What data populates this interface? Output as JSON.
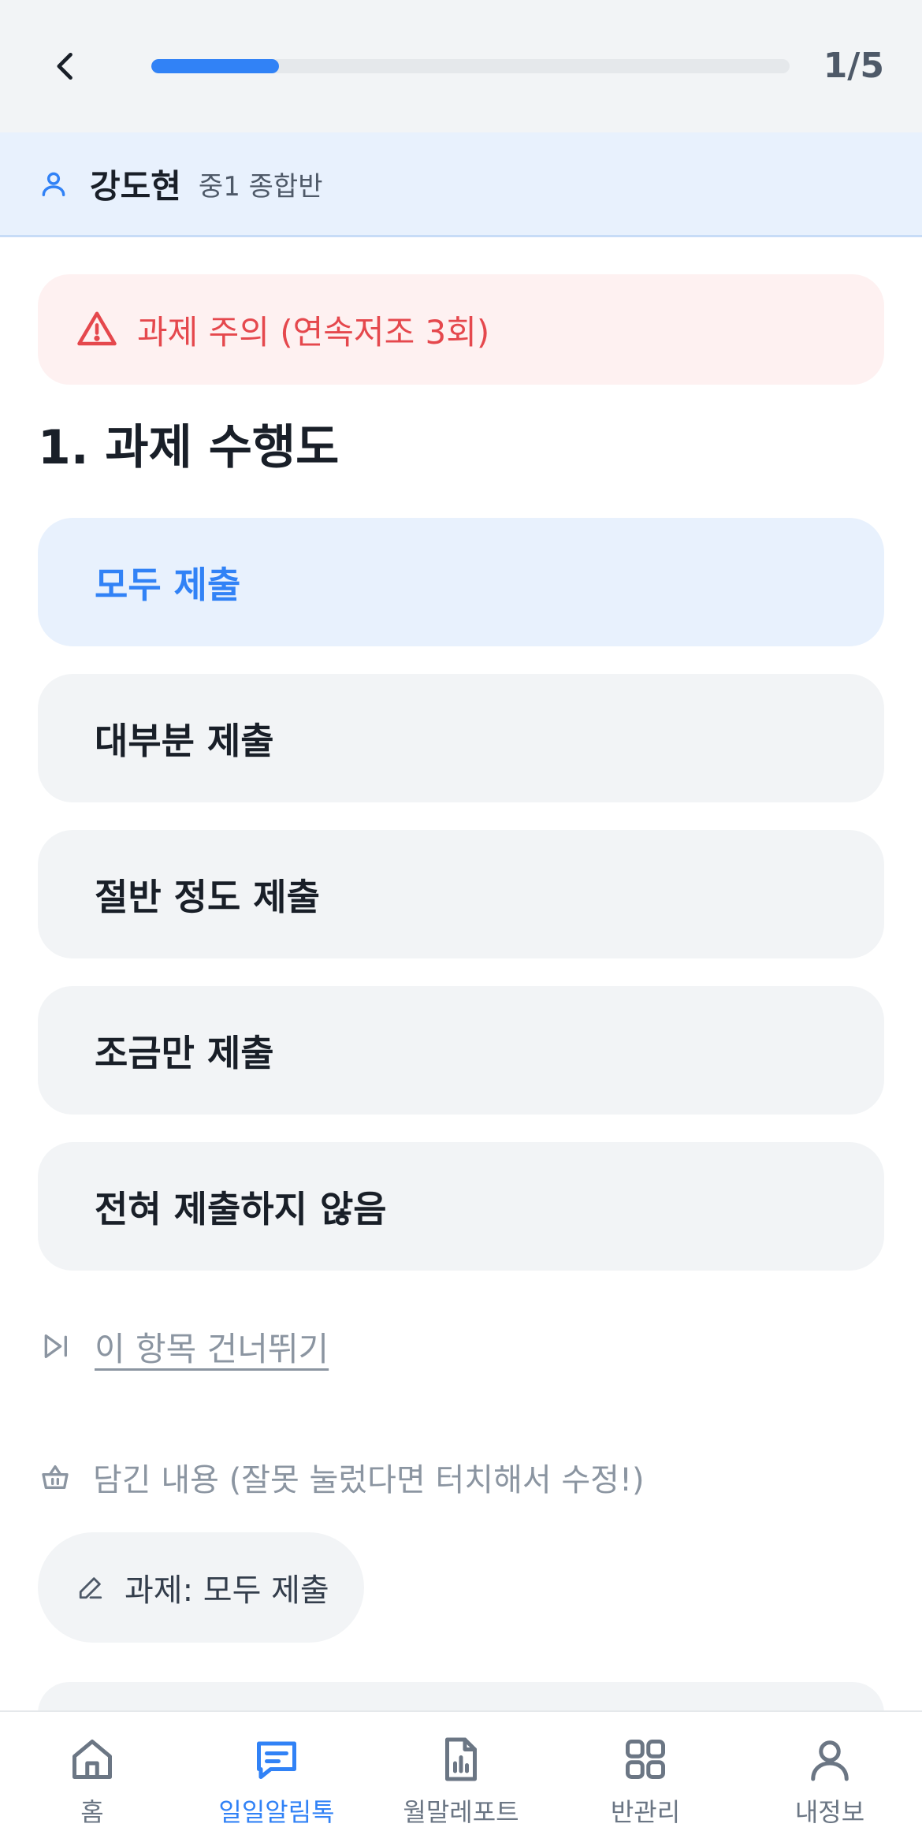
{
  "header": {
    "step_counter": "1/5",
    "progress": 0.2
  },
  "student": {
    "name": "강도현",
    "class_name": "중1 종합반"
  },
  "warning": {
    "text": "과제 주의 (연속저조 3회)"
  },
  "question": {
    "title": "1. 과제 수행도",
    "options": [
      {
        "label": "모두 제출",
        "selected": true
      },
      {
        "label": "대부분 제출",
        "selected": false
      },
      {
        "label": "절반 정도 제출",
        "selected": false
      },
      {
        "label": "조금만 제출",
        "selected": false
      },
      {
        "label": "전혀 제출하지 않음",
        "selected": false
      }
    ]
  },
  "skip": {
    "label": "이 항목 건너뛰기"
  },
  "basket": {
    "label": "담긴 내용 (잘못 눌렀다면 터치해서 수정!)",
    "chips": [
      {
        "label": "과제: 모두 제출"
      }
    ]
  },
  "tabbar": {
    "tabs": [
      {
        "label": "홈",
        "icon": "home-icon",
        "active": false
      },
      {
        "label": "일일알림톡",
        "icon": "message-icon",
        "active": true
      },
      {
        "label": "월말레포트",
        "icon": "report-icon",
        "active": false
      },
      {
        "label": "반관리",
        "icon": "grid-icon",
        "active": false
      },
      {
        "label": "내정보",
        "icon": "user-icon",
        "active": false
      }
    ]
  },
  "colors": {
    "accent": "#3182f6",
    "warning": "#e5484d",
    "muted": "#8b95a1"
  }
}
